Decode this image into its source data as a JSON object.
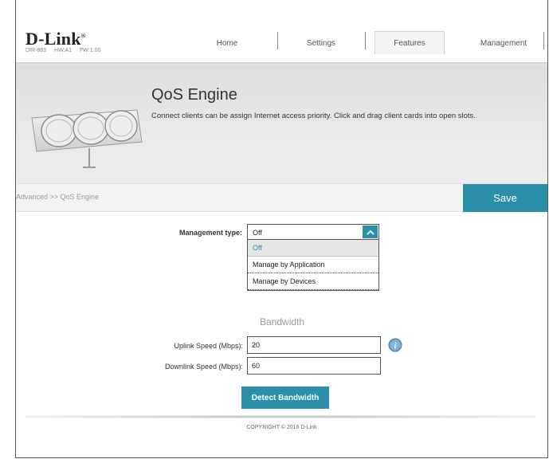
{
  "brand": {
    "logo": "D-Link",
    "trademark": "®",
    "model": "DIR-883",
    "hw": "HW:A1",
    "fw": "FW:1.00"
  },
  "nav": {
    "home": "Home",
    "settings": "Settings",
    "features": "Features",
    "management": "Management",
    "active": "Features"
  },
  "banner": {
    "title": "QoS Engine",
    "description": "Connect clients can be assign Internet access priority. Click and drag client cards into open slots."
  },
  "breadcrumb": "Advanced >> QoS Engine",
  "save_label": "Save",
  "form": {
    "management_type_label": "Management type:",
    "management_type_value": "Off",
    "options": [
      "Off",
      "Manage by Application",
      "Manage by Devices"
    ],
    "selected_option_index": 0,
    "bandwidth_title": "Bandwidth",
    "uplink_label": "Uplink Speed (Mbps):",
    "uplink_value": "20",
    "downlink_label": "Downlink Speed (Mbps):",
    "downlink_value": "60",
    "detect_label": "Detect Bandwidth"
  },
  "footer": {
    "copyright": "COPYRIGHT © 2016 D-Link"
  },
  "colors": {
    "accent": "#2a8fa8",
    "banner_bg": "#e4e4e4"
  },
  "icons": {
    "dropdown": "chevron-up-icon",
    "info": "info-icon",
    "graphic": "qos-engine-graphic"
  }
}
